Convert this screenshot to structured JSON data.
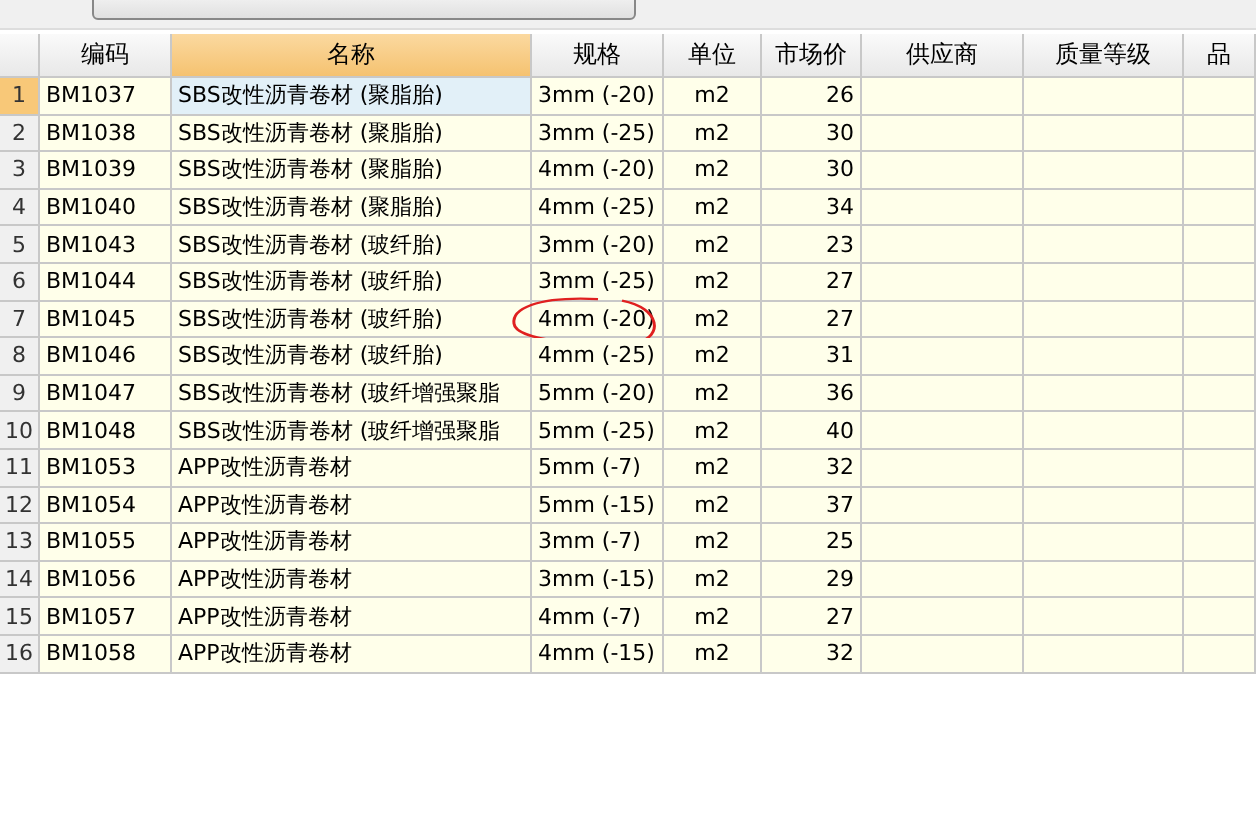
{
  "columns": [
    {
      "label": "编码",
      "selected": false
    },
    {
      "label": "名称",
      "selected": true
    },
    {
      "label": "规格",
      "selected": false
    },
    {
      "label": "单位",
      "selected": false
    },
    {
      "label": "市场价",
      "selected": false
    },
    {
      "label": "供应商",
      "selected": false
    },
    {
      "label": "质量等级",
      "selected": false
    },
    {
      "label": "品",
      "selected": false
    }
  ],
  "rows": [
    {
      "num": "1",
      "code": "BM1037",
      "name": "SBS改性沥青卷材 (聚脂胎)",
      "spec": "3mm (-20)",
      "unit": "m2",
      "price": "26",
      "selected": true,
      "circled": false
    },
    {
      "num": "2",
      "code": "BM1038",
      "name": "SBS改性沥青卷材 (聚脂胎)",
      "spec": "3mm (-25)",
      "unit": "m2",
      "price": "30",
      "selected": false,
      "circled": false
    },
    {
      "num": "3",
      "code": "BM1039",
      "name": "SBS改性沥青卷材 (聚脂胎)",
      "spec": "4mm (-20)",
      "unit": "m2",
      "price": "30",
      "selected": false,
      "circled": false
    },
    {
      "num": "4",
      "code": "BM1040",
      "name": "SBS改性沥青卷材 (聚脂胎)",
      "spec": "4mm (-25)",
      "unit": "m2",
      "price": "34",
      "selected": false,
      "circled": false
    },
    {
      "num": "5",
      "code": "BM1043",
      "name": "SBS改性沥青卷材 (玻纤胎)",
      "spec": "3mm (-20)",
      "unit": "m2",
      "price": "23",
      "selected": false,
      "circled": false
    },
    {
      "num": "6",
      "code": "BM1044",
      "name": "SBS改性沥青卷材 (玻纤胎)",
      "spec": "3mm (-25)",
      "unit": "m2",
      "price": "27",
      "selected": false,
      "circled": false
    },
    {
      "num": "7",
      "code": "BM1045",
      "name": "SBS改性沥青卷材 (玻纤胎)",
      "spec": "4mm (-20)",
      "unit": "m2",
      "price": "27",
      "selected": false,
      "circled": true
    },
    {
      "num": "8",
      "code": "BM1046",
      "name": "SBS改性沥青卷材 (玻纤胎)",
      "spec": "4mm (-25)",
      "unit": "m2",
      "price": "31",
      "selected": false,
      "circled": false
    },
    {
      "num": "9",
      "code": "BM1047",
      "name": "SBS改性沥青卷材 (玻纤增强聚脂",
      "spec": "5mm (-20)",
      "unit": "m2",
      "price": "36",
      "selected": false,
      "circled": false
    },
    {
      "num": "10",
      "code": "BM1048",
      "name": "SBS改性沥青卷材 (玻纤增强聚脂",
      "spec": "5mm (-25)",
      "unit": "m2",
      "price": "40",
      "selected": false,
      "circled": false
    },
    {
      "num": "11",
      "code": "BM1053",
      "name": "APP改性沥青卷材",
      "spec": "5mm (-7)",
      "unit": "m2",
      "price": "32",
      "selected": false,
      "circled": false
    },
    {
      "num": "12",
      "code": "BM1054",
      "name": "APP改性沥青卷材",
      "spec": "5mm (-15)",
      "unit": "m2",
      "price": "37",
      "selected": false,
      "circled": false
    },
    {
      "num": "13",
      "code": "BM1055",
      "name": "APP改性沥青卷材",
      "spec": "3mm (-7)",
      "unit": "m2",
      "price": "25",
      "selected": false,
      "circled": false
    },
    {
      "num": "14",
      "code": "BM1056",
      "name": "APP改性沥青卷材",
      "spec": "3mm (-15)",
      "unit": "m2",
      "price": "29",
      "selected": false,
      "circled": false
    },
    {
      "num": "15",
      "code": "BM1057",
      "name": "APP改性沥青卷材",
      "spec": "4mm (-7)",
      "unit": "m2",
      "price": "27",
      "selected": false,
      "circled": false
    },
    {
      "num": "16",
      "code": "BM1058",
      "name": "APP改性沥青卷材",
      "spec": "4mm (-15)",
      "unit": "m2",
      "price": "32",
      "selected": false,
      "circled": false
    }
  ]
}
